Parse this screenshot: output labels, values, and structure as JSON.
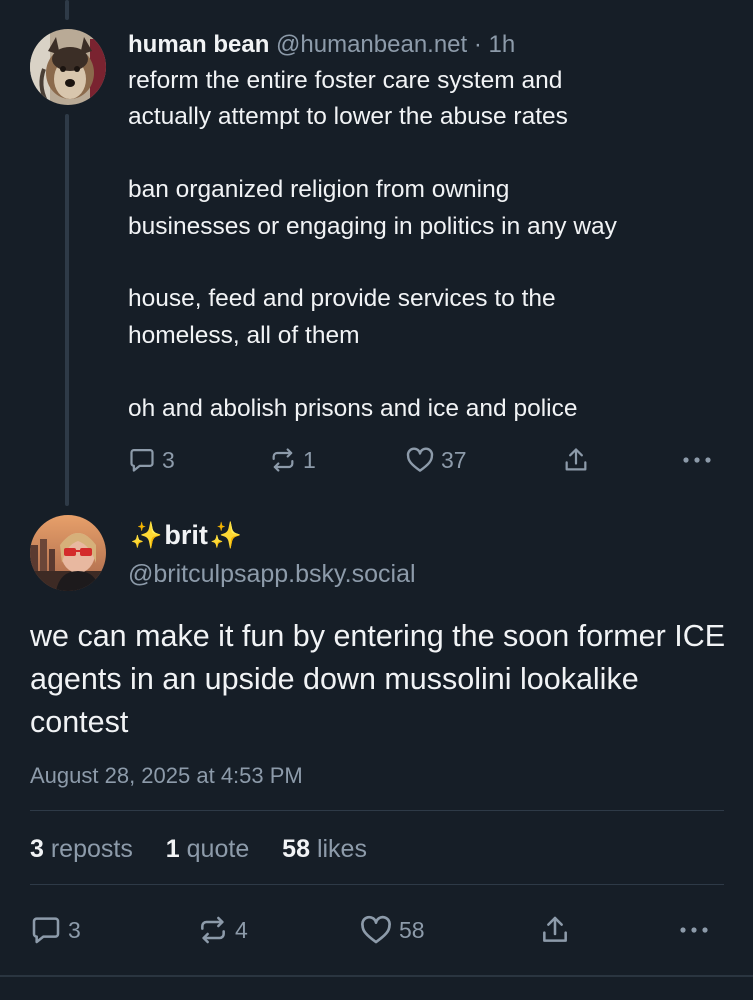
{
  "parent_post": {
    "display_name": "human bean",
    "handle": "@humanbean.net",
    "separator": "·",
    "time": "1h",
    "body": "reform the entire foster care system and\nactually attempt to lower the abuse rates\n\nban organized religion from owning\nbusinesses or engaging in politics in any way\n\nhouse, feed and provide services to the\nhomeless, all of them\n\noh and abolish prisons and ice and police",
    "replies": "3",
    "reposts": "1",
    "likes": "37"
  },
  "main_post": {
    "display_name": "brit",
    "name_emoji": "✨",
    "handle": "@britculpsapp.bsky.social",
    "body": "we can make it fun by entering the soon former ICE agents in an upside down mussolini lookalike contest",
    "timestamp": "August 28, 2025 at 4:53 PM",
    "stats": {
      "reposts_count": "3",
      "reposts_label": "reposts",
      "quotes_count": "1",
      "quotes_label": "quote",
      "likes_count": "58",
      "likes_label": "likes"
    },
    "actions": {
      "replies": "3",
      "reposts": "4",
      "likes": "58"
    }
  },
  "colors": {
    "background": "#161e27",
    "text": "#f1f3f5",
    "muted": "#8d9baa",
    "divider": "#2e3a47"
  },
  "icons": [
    "reply-icon",
    "repost-icon",
    "like-icon",
    "share-icon",
    "more-icon"
  ]
}
